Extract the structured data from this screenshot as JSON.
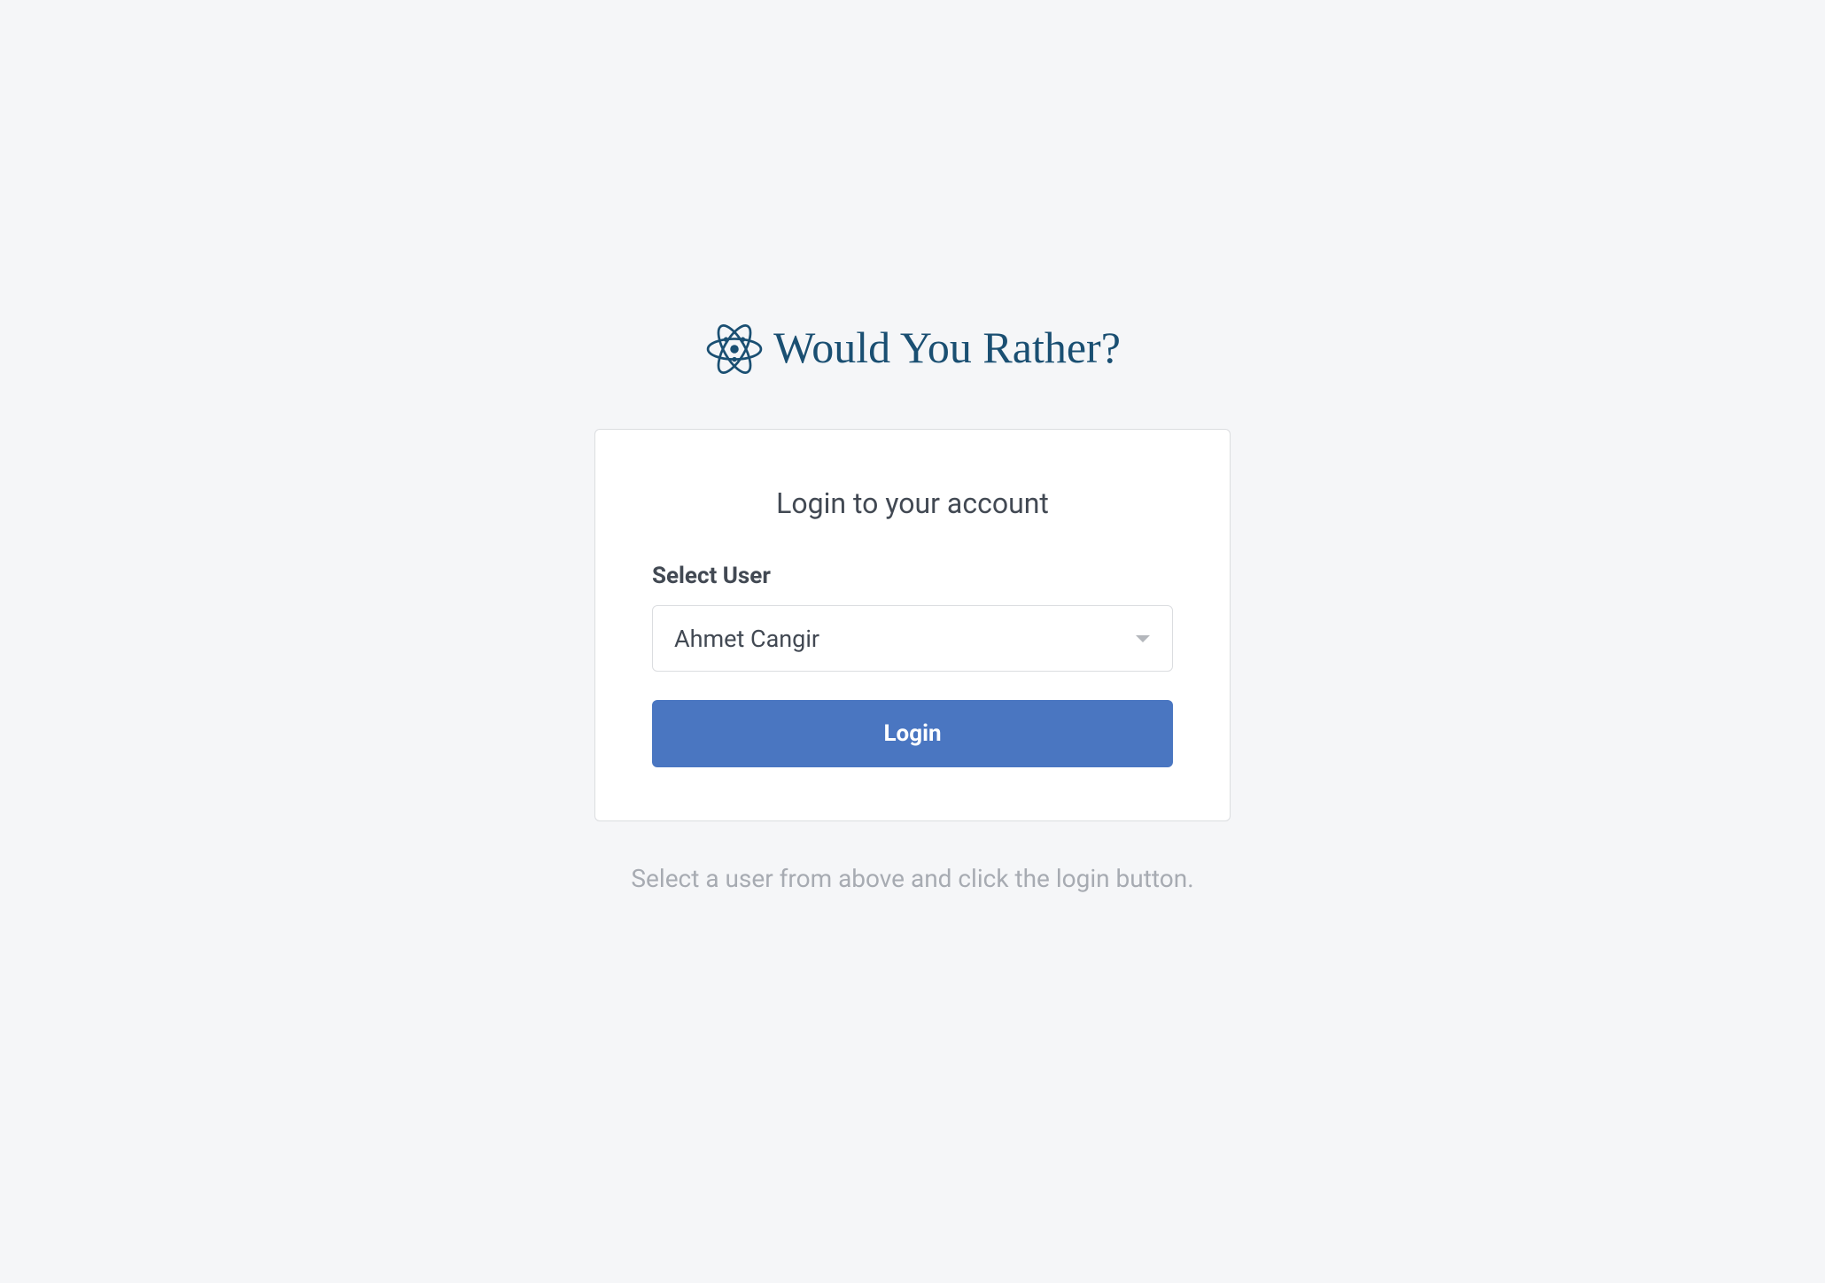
{
  "header": {
    "title": "Would You Rather?",
    "icon": "atom-icon"
  },
  "card": {
    "title": "Login to your account",
    "select_label": "Select User",
    "selected_user": "Ahmet Cangir",
    "login_button_label": "Login"
  },
  "helper": {
    "text": "Select a user from above and click the login button."
  },
  "colors": {
    "background": "#f5f6f8",
    "brand": "#1a4f72",
    "button": "#4a76c1",
    "text_primary": "#424953",
    "text_muted": "#a7abb2"
  }
}
